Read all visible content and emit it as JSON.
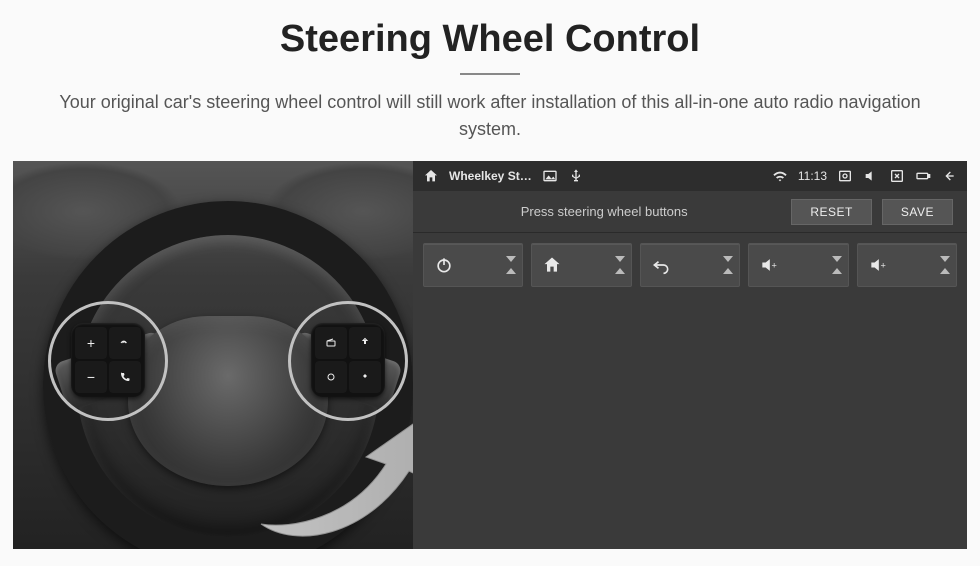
{
  "header": {
    "title": "Steering Wheel Control",
    "subtitle": "Your original car's steering wheel control will still work after installation of this all-in-one auto radio navigation system."
  },
  "status_bar": {
    "app_title": "Wheelkey St…",
    "clock": "11:13"
  },
  "toolbar": {
    "hint": "Press steering wheel buttons",
    "reset_label": "RESET",
    "save_label": "SAVE"
  },
  "fn_buttons": [
    {
      "name": "power",
      "glyph": "power"
    },
    {
      "name": "home",
      "glyph": "home"
    },
    {
      "name": "back",
      "glyph": "back"
    },
    {
      "name": "volume-up-1",
      "glyph": "vol-up"
    },
    {
      "name": "volume-up-2",
      "glyph": "vol-up"
    }
  ],
  "wheel_buttons_left": [
    "+",
    "voice",
    "−",
    "phone"
  ],
  "wheel_buttons_right": [
    "radio",
    "source",
    "cycle",
    "nav"
  ]
}
